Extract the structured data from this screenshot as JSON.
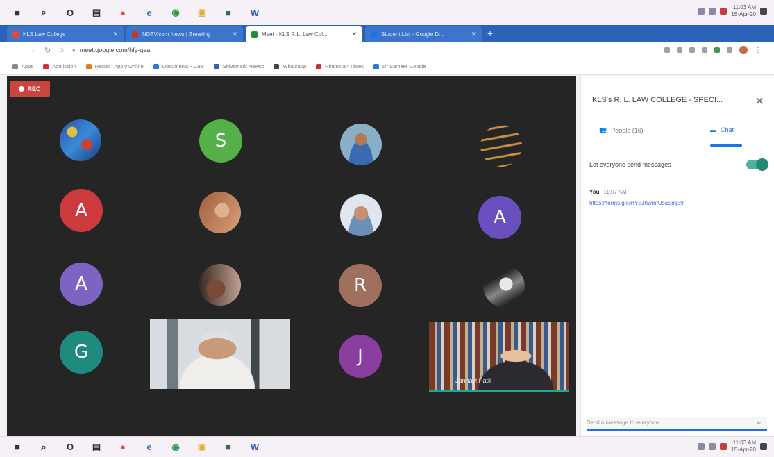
{
  "taskbar": {
    "icons": [
      {
        "name": "start-icon",
        "glyph": "■",
        "color": "#333333"
      },
      {
        "name": "search-icon",
        "glyph": "⌕",
        "color": "#333333"
      },
      {
        "name": "cortana-icon",
        "glyph": "O",
        "color": "#333333"
      },
      {
        "name": "task-view-icon",
        "glyph": "▤",
        "color": "#333333"
      },
      {
        "name": "media-icon",
        "glyph": "●",
        "color": "#e0503a"
      },
      {
        "name": "edge-icon",
        "glyph": "e",
        "color": "#2d73d8"
      },
      {
        "name": "chrome-icon",
        "glyph": "◉",
        "color": "#2e9a4a"
      },
      {
        "name": "explorer-icon",
        "glyph": "▣",
        "color": "#e0b030"
      },
      {
        "name": "app-icon",
        "glyph": "■",
        "color": "#3a6a4a"
      },
      {
        "name": "word-icon",
        "glyph": "W",
        "color": "#2b5fb8"
      }
    ],
    "clock_time": "11:03 AM",
    "clock_date": "15-Apr-20"
  },
  "tabs": [
    {
      "label": "KLS Law College",
      "active": false,
      "fav": "#e04a3a"
    },
    {
      "label": "NDTV.com News | Breaking",
      "active": false,
      "fav": "#c0392b"
    },
    {
      "label": "Meet - KLS R.L. Law Col...",
      "active": true,
      "fav": "#1e8e3e"
    },
    {
      "label": "Student List - Google D...",
      "active": false,
      "fav": "#1a73e8"
    }
  ],
  "address": {
    "url": "meet.google.com/hfy-qaa"
  },
  "bookmarks": [
    {
      "label": "Apps",
      "fav": "#888888"
    },
    {
      "label": "Admission",
      "fav": "#cc3333"
    },
    {
      "label": "Result - Apply Online",
      "fav": "#e07b20"
    },
    {
      "label": "Documents - Gals",
      "fav": "#2a7ad6"
    },
    {
      "label": "Shivsmark Newsc",
      "fav": "#3a5fb8"
    },
    {
      "label": "Whatsapp",
      "fav": "#444444"
    },
    {
      "label": "Hindustan Times",
      "fav": "#cc3333"
    },
    {
      "label": "Dr Sameer Google",
      "fav": "#2a7ad6"
    }
  ],
  "meet": {
    "rec_label": "REC",
    "avatars": [
      {
        "letter": "S",
        "color": "#55b04a"
      },
      {
        "letter": "A",
        "color": "#cc3a3e"
      },
      {
        "letter": "A",
        "color": "#6a4fbf"
      },
      {
        "letter": "A",
        "color": "#7e64c2"
      },
      {
        "letter": "R",
        "color": "#a0705e"
      },
      {
        "letter": "G",
        "color": "#1f8a7e"
      },
      {
        "letter": "J",
        "color": "#8a3fa0"
      }
    ],
    "student_tile_name": "Janhavi Patil"
  },
  "panel": {
    "title": "KLS's R. L. LAW COLLEGE - SPECI...",
    "tab_people": "People (16)",
    "tab_chat": "Chat",
    "setting": "Let everyone send messages",
    "message": {
      "sender": "You",
      "time": "11:07 AM",
      "link": "https://forms.gle/HYBJhwmfUsaSmj59"
    },
    "input_placeholder": "Send a message to everyone"
  }
}
